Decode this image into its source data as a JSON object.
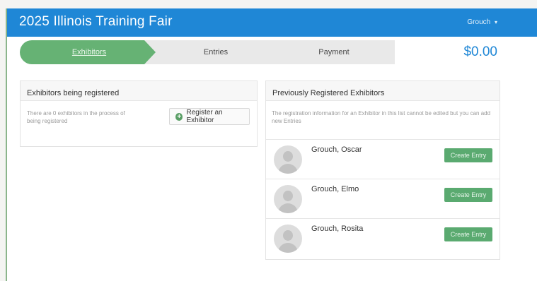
{
  "header": {
    "title": "2025 Illinois Training Fair",
    "user": "Grouch",
    "user_caret": "▾"
  },
  "steps": [
    {
      "label": "Exhibitors"
    },
    {
      "label": "Entries"
    },
    {
      "label": "Payment"
    }
  ],
  "total": "$0.00",
  "left_panel": {
    "title": "Exhibitors being registered",
    "note": "There are 0 exhibitors in the process of being registered",
    "register_label": "Register an Exhibitor",
    "register_icon": "plus-circle-icon"
  },
  "right_panel": {
    "title": "Previously Registered Exhibitors",
    "note": "The registration information for an Exhibitor in this list cannot be edited but you can add new Entries",
    "exhibitors": [
      {
        "name": "Grouch, Oscar",
        "action": "Create Entry"
      },
      {
        "name": "Grouch, Elmo",
        "action": "Create Entry"
      },
      {
        "name": "Grouch, Rosita",
        "action": "Create Entry"
      }
    ]
  },
  "colors": {
    "topbar": "#1f87d6",
    "step_active": "#66b274",
    "step_inactive": "#e9e9e9",
    "total": "#1f87d6",
    "create_button": "#5aaa70"
  }
}
